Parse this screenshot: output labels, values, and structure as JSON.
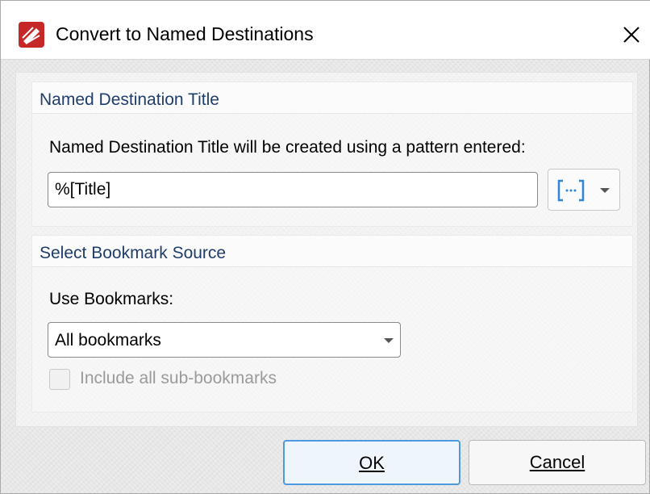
{
  "window": {
    "title": "Convert to Named Destinations",
    "close_icon": "close-icon",
    "app_icon": "pdf-xchange-logo"
  },
  "destination_group": {
    "title": "Named Destination Title",
    "description": "Named Destination Title will be created using a pattern entered:",
    "pattern_value": "%[Title]",
    "macro_button_icon": "macro-bracket-icon"
  },
  "bookmark_group": {
    "title": "Select Bookmark Source",
    "use_bookmarks_label": "Use Bookmarks:",
    "selected_option": "All bookmarks",
    "include_sub_label": "Include all sub-bookmarks",
    "include_sub_checked": false,
    "include_sub_enabled": false
  },
  "buttons": {
    "ok_label": "OK",
    "cancel_label": "Cancel"
  },
  "colors": {
    "accent_blue": "#4e9ae0",
    "group_title": "#1f3d6b"
  }
}
